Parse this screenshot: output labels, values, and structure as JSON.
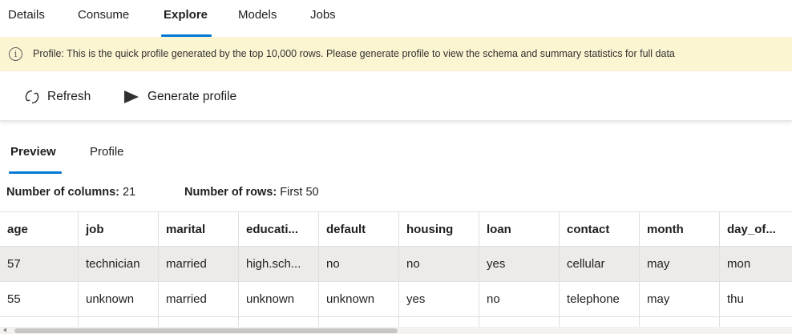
{
  "top_tabs": [
    {
      "label": "Details"
    },
    {
      "label": "Consume"
    },
    {
      "label": "Explore"
    },
    {
      "label": "Models"
    },
    {
      "label": "Jobs"
    }
  ],
  "active_top_tab": "Explore",
  "banner": {
    "icon": "info-icon",
    "icon_glyph": "i",
    "text": "Profile: This is the quick profile generated by the top 10,000 rows. Please generate profile to view the schema and summary statistics for full data"
  },
  "commands": {
    "refresh_label": "Refresh",
    "refresh_icon": "refresh-icon",
    "generate_label": "Generate profile",
    "generate_icon": "play-icon"
  },
  "inner_tabs": [
    {
      "label": "Preview"
    },
    {
      "label": "Profile"
    }
  ],
  "active_inner_tab": "Preview",
  "summary": {
    "columns_label": "Number of columns:",
    "columns_value": "21",
    "rows_label": "Number of rows:",
    "rows_value": "First 50"
  },
  "table": {
    "columns": [
      "age",
      "job",
      "marital",
      "educati...",
      "default",
      "housing",
      "loan",
      "contact",
      "month",
      "day_of..."
    ],
    "rows": [
      [
        "57",
        "technician",
        "married",
        "high.sch...",
        "no",
        "no",
        "yes",
        "cellular",
        "may",
        "mon"
      ],
      [
        "55",
        "unknown",
        "married",
        "unknown",
        "unknown",
        "yes",
        "no",
        "telephone",
        "may",
        "thu"
      ]
    ]
  },
  "colors": {
    "accent": "#0078d4",
    "banner_bg": "#fcf5d2",
    "selected_row_bg": "#edebe9"
  }
}
